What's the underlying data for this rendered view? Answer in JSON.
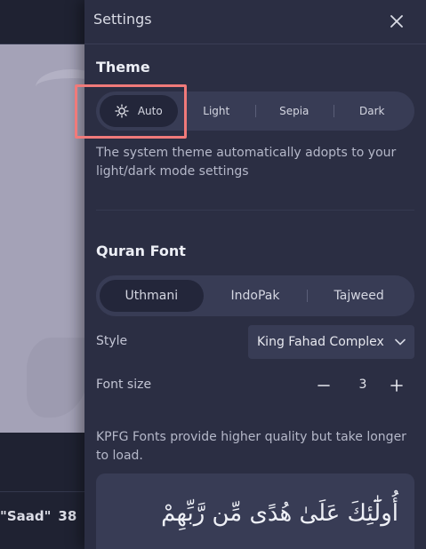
{
  "background": {
    "verse_ref_name": "\"Saad\"",
    "verse_ref_number": "38"
  },
  "panel": {
    "title": "Settings",
    "close_icon": "close-icon"
  },
  "theme": {
    "title": "Theme",
    "options": [
      "Auto",
      "Light",
      "Sepia",
      "Dark"
    ],
    "selected": "Auto",
    "description": "The system theme automatically adopts to your light/dark mode settings"
  },
  "quran_font": {
    "title": "Quran Font",
    "options": [
      "Uthmani",
      "IndoPak",
      "Tajweed"
    ],
    "selected": "Uthmani",
    "style_label": "Style",
    "style_value": "King Fahad Complex",
    "font_size_label": "Font size",
    "font_size_value": "3",
    "note": "KPFG Fonts provide higher quality but take longer to load.",
    "preview_text": "أُولَٰٓئِكَ عَلَىٰ هُدًى مِّن رَّبِّهِمْ"
  },
  "colors": {
    "panel_bg": "#2b2e43",
    "control_bg": "#383c55",
    "active_bg": "#23263a",
    "highlight": "#f07a7a"
  }
}
